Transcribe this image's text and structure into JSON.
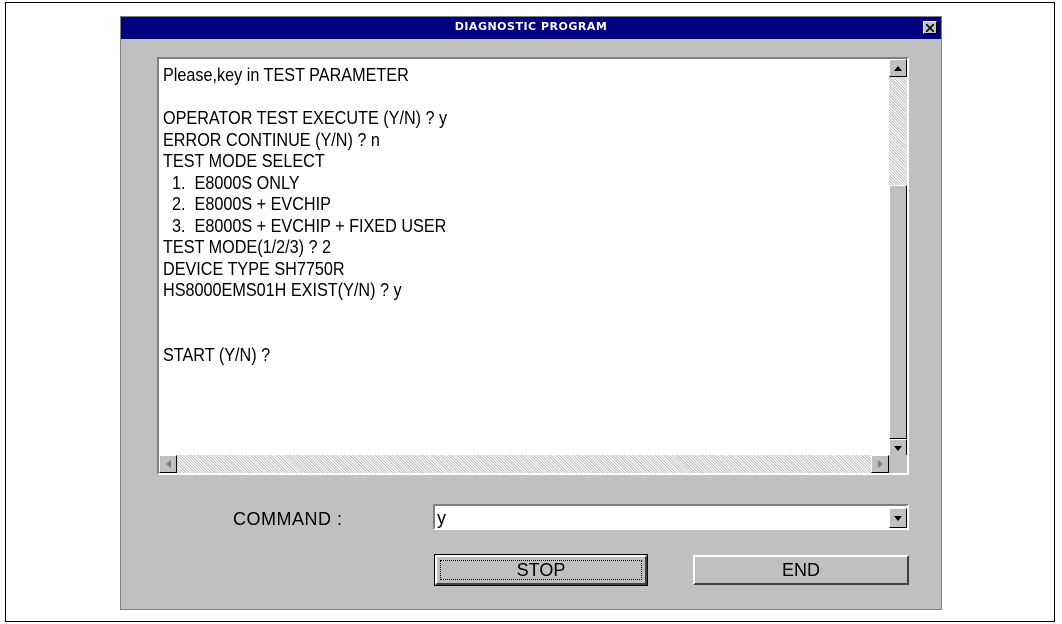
{
  "window": {
    "title": "DIAGNOSTIC  PROGRAM",
    "close_glyph": "✕"
  },
  "console": {
    "lines": [
      "Please,key in TEST PARAMETER",
      "",
      "OPERATOR TEST EXECUTE (Y/N) ? y",
      "ERROR CONTINUE (Y/N) ? n",
      "TEST MODE SELECT",
      "  1.  E8000S ONLY",
      "  2.  E8000S + EVCHIP",
      "  3.  E8000S + EVCHIP + FIXED USER",
      "TEST MODE(1/2/3) ? 2",
      "DEVICE TYPE SH7750R",
      "HS8000EMS01H EXIST(Y/N) ? y",
      "",
      "",
      "START (Y/N) ?"
    ]
  },
  "command": {
    "label": "COMMAND   :",
    "value": "y"
  },
  "buttons": {
    "stop": "STOP",
    "end": "END"
  },
  "colors": {
    "title_bar": "#000080",
    "window_face": "#c0c0c0"
  }
}
